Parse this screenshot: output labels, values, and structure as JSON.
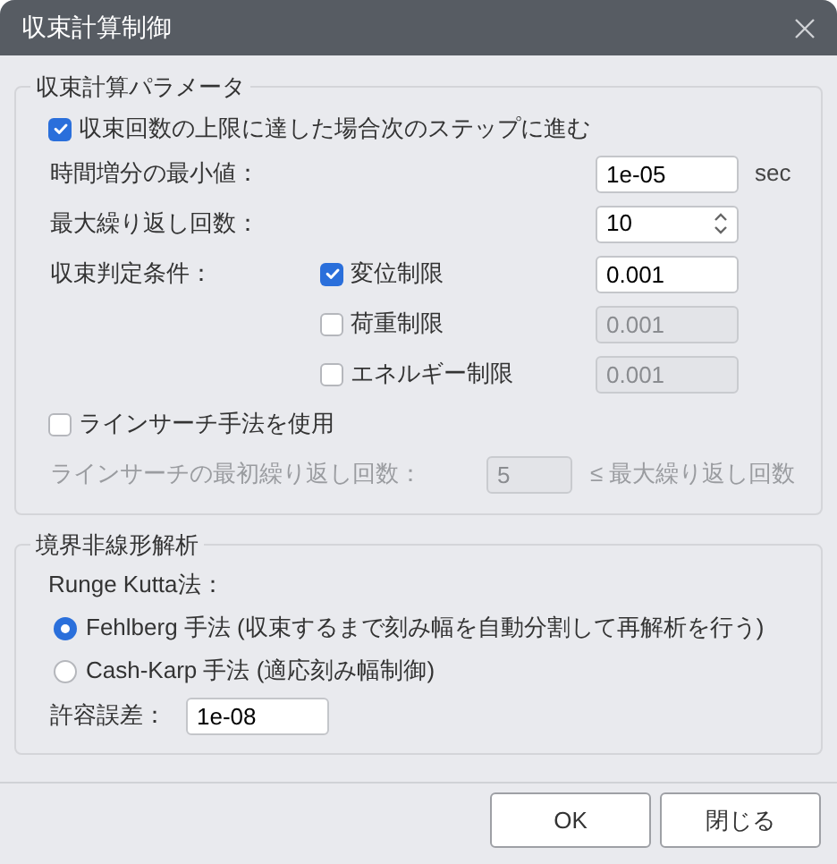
{
  "window": {
    "title": "収束計算制御"
  },
  "convergence_group": {
    "legend": "収束計算パラメータ",
    "stop_option": {
      "label": "収束回数の上限に達した場合次のステップに進む",
      "checked": true
    },
    "min_time_increment": {
      "label": "時間増分の最小値：",
      "value": "1e-05",
      "unit": "sec"
    },
    "max_iterations": {
      "label": "最大繰り返し回数：",
      "value": "10"
    },
    "criteria": {
      "label": "収束判定条件：",
      "items": [
        {
          "label": "変位制限",
          "checked": true,
          "value": "0.001"
        },
        {
          "label": "荷重制限",
          "checked": false,
          "value": "0.001"
        },
        {
          "label": "エネルギー制限",
          "checked": false,
          "value": "0.001"
        }
      ]
    },
    "line_search": {
      "label": "ラインサーチ手法を使用",
      "checked": false
    },
    "line_search_initial": {
      "label": "ラインサーチの最初繰り返し回数：",
      "value": "5",
      "note": "≤ 最大繰り返し回数"
    }
  },
  "boundary_group": {
    "legend": "境界非線形解析",
    "method_label": "Runge Kutta法：",
    "methods": [
      {
        "label": "Fehlberg 手法 (収束するまで刻み幅を自動分割して再解析を行う)",
        "selected": true
      },
      {
        "label": "Cash-Karp 手法 (適応刻み幅制御)",
        "selected": false
      }
    ],
    "tolerance": {
      "label": "許容誤差：",
      "value": "1e-08"
    }
  },
  "buttons": [
    "OK",
    "閉じる"
  ]
}
